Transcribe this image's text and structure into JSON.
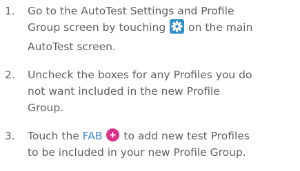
{
  "steps": [
    {
      "number": "1.",
      "text_a": "Go to the AutoTest Settings and Profile",
      "text_b": "Group screen by touching",
      "text_c": "on the main",
      "text_d": "AutoTest screen."
    },
    {
      "number": "2.",
      "line1": "Uncheck the boxes for any Profiles you do",
      "line2": "not want included in the new Profile",
      "line3": "Group."
    },
    {
      "number": "3.",
      "text_a": "Touch the",
      "link": "FAB",
      "text_b": "to add new test Profiles",
      "line2": "to be included in your new Profile Group."
    }
  ],
  "icons": {
    "settings": "gear-icon",
    "fab": "plus-circle-icon"
  },
  "colors": {
    "text": "#5f5f5f",
    "link": "#3b8bd3",
    "gear_bg": "#2f8fc9",
    "fab_bg": "#d6338a"
  }
}
